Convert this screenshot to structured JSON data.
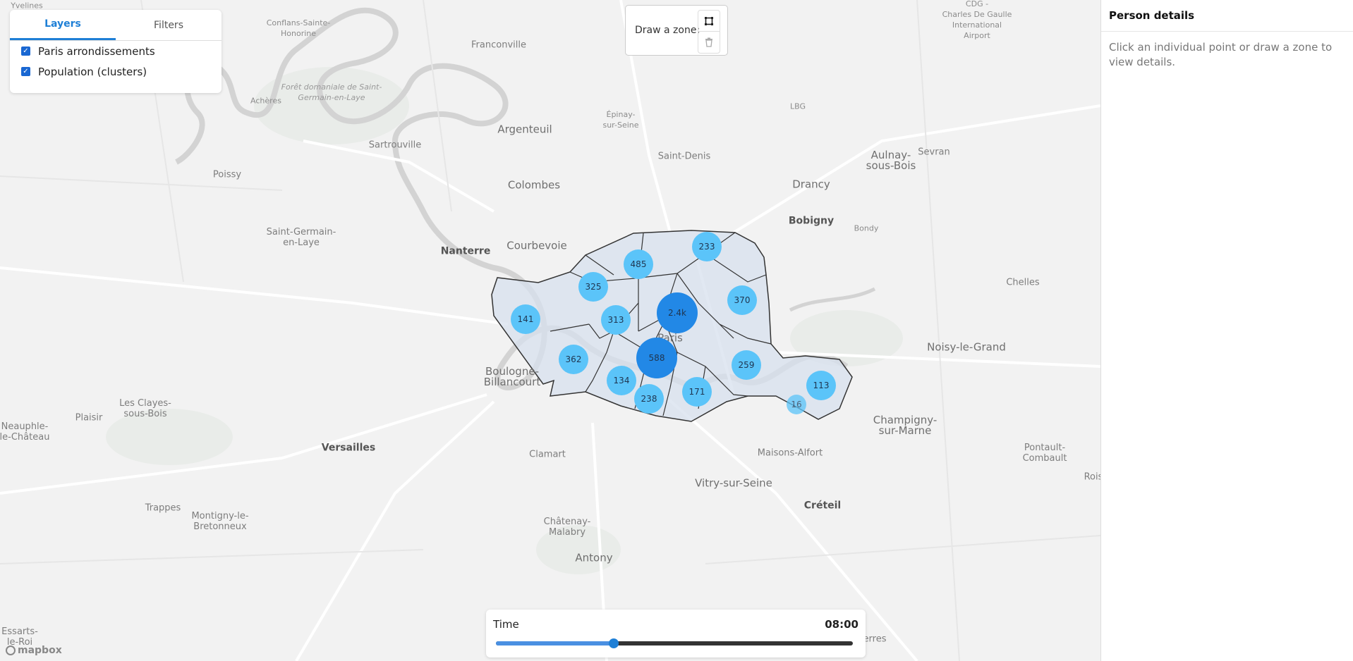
{
  "layers_panel": {
    "tabs": [
      {
        "label": "Layers",
        "active": true
      },
      {
        "label": "Filters",
        "active": false
      }
    ],
    "layers": [
      {
        "label": "Paris arrondissements",
        "checked": true
      },
      {
        "label": "Population (clusters)",
        "checked": true
      }
    ]
  },
  "draw_zone": {
    "label": "Draw a zone:",
    "tools": [
      "polygon-icon",
      "trash-icon"
    ]
  },
  "time": {
    "label": "Time",
    "value": "08:00",
    "slider_fraction": 0.33
  },
  "side_panel": {
    "title": "Person details",
    "message": "Click an individual point or draw a zone to view details."
  },
  "attribution": "mapbox",
  "colors": {
    "accent": "#1e7fd6",
    "cluster_light": "#5bc4f9",
    "cluster_dark": "#2288e6",
    "zone_fill": "#d7e0ee"
  },
  "map": {
    "places": [
      {
        "id": "yvelines",
        "text": "Yvelines"
      },
      {
        "id": "conflans",
        "text": "Conflans-Sainte-\nHonorine"
      },
      {
        "id": "franconville",
        "text": "Franconville"
      },
      {
        "id": "cdg",
        "text": "CDG -\nCharles De Gaulle\nInternational\nAirport"
      },
      {
        "id": "foret",
        "text": "Forêt domaniale de Saint-\nGermain-en-Laye"
      },
      {
        "id": "acheres",
        "text": "Achères"
      },
      {
        "id": "epinay",
        "text": "Épinay-\nsur-Seine"
      },
      {
        "id": "argenteuil",
        "text": "Argenteuil"
      },
      {
        "id": "lbg",
        "text": "LBG"
      },
      {
        "id": "sartrouville",
        "text": "Sartrouville"
      },
      {
        "id": "saintdenis",
        "text": "Saint-Denis"
      },
      {
        "id": "aulnay",
        "text": "Aulnay-\nsous-Bois"
      },
      {
        "id": "sevran",
        "text": "Sevran"
      },
      {
        "id": "poissy",
        "text": "Poissy"
      },
      {
        "id": "colombes",
        "text": "Colombes"
      },
      {
        "id": "drancy",
        "text": "Drancy"
      },
      {
        "id": "bobigny",
        "text": "Bobigny"
      },
      {
        "id": "bondy",
        "text": "Bondy"
      },
      {
        "id": "stgermain",
        "text": "Saint-Germain-\nen-Laye"
      },
      {
        "id": "nanterre",
        "text": "Nanterre"
      },
      {
        "id": "courbevoie",
        "text": "Courbevoie"
      },
      {
        "id": "chelles",
        "text": "Chelles"
      },
      {
        "id": "paris",
        "text": "Paris"
      },
      {
        "id": "noisy",
        "text": "Noisy-le-Grand"
      },
      {
        "id": "boulogne",
        "text": "Boulogne-\nBillancourt"
      },
      {
        "id": "lesclayes",
        "text": "Les Clayes-\nsous-Bois"
      },
      {
        "id": "plaisir",
        "text": "Plaisir"
      },
      {
        "id": "neauphle",
        "text": "Neauphle-\nle-Château"
      },
      {
        "id": "versailles",
        "text": "Versailles"
      },
      {
        "id": "champigny",
        "text": "Champigny-\nsur-Marne"
      },
      {
        "id": "pontault",
        "text": "Pontault-\nCombault"
      },
      {
        "id": "clamart",
        "text": "Clamart"
      },
      {
        "id": "maisons",
        "text": "Maisons-Alfort"
      },
      {
        "id": "vitry",
        "text": "Vitry-sur-Seine"
      },
      {
        "id": "creteil",
        "text": "Créteil"
      },
      {
        "id": "roi",
        "text": "Rois"
      },
      {
        "id": "trappes",
        "text": "Trappes"
      },
      {
        "id": "montigny",
        "text": "Montigny-le-\nBretonneux"
      },
      {
        "id": "chatenay",
        "text": "Châtenay-\nMalabry"
      },
      {
        "id": "antony",
        "text": "Antony"
      },
      {
        "id": "essarts",
        "text": "Essarts-\nle-Roi"
      },
      {
        "id": "erres",
        "text": "erres"
      }
    ],
    "clusters": [
      {
        "label": "233",
        "count": 233
      },
      {
        "label": "485",
        "count": 485
      },
      {
        "label": "325",
        "count": 325
      },
      {
        "label": "370",
        "count": 370
      },
      {
        "label": "2.4k",
        "count": 2400
      },
      {
        "label": "141",
        "count": 141
      },
      {
        "label": "313",
        "count": 313
      },
      {
        "label": "362",
        "count": 362
      },
      {
        "label": "588",
        "count": 588
      },
      {
        "label": "259",
        "count": 259
      },
      {
        "label": "134",
        "count": 134
      },
      {
        "label": "113",
        "count": 113
      },
      {
        "label": "171",
        "count": 171
      },
      {
        "label": "238",
        "count": 238
      },
      {
        "label": "16",
        "count": 16
      }
    ]
  }
}
